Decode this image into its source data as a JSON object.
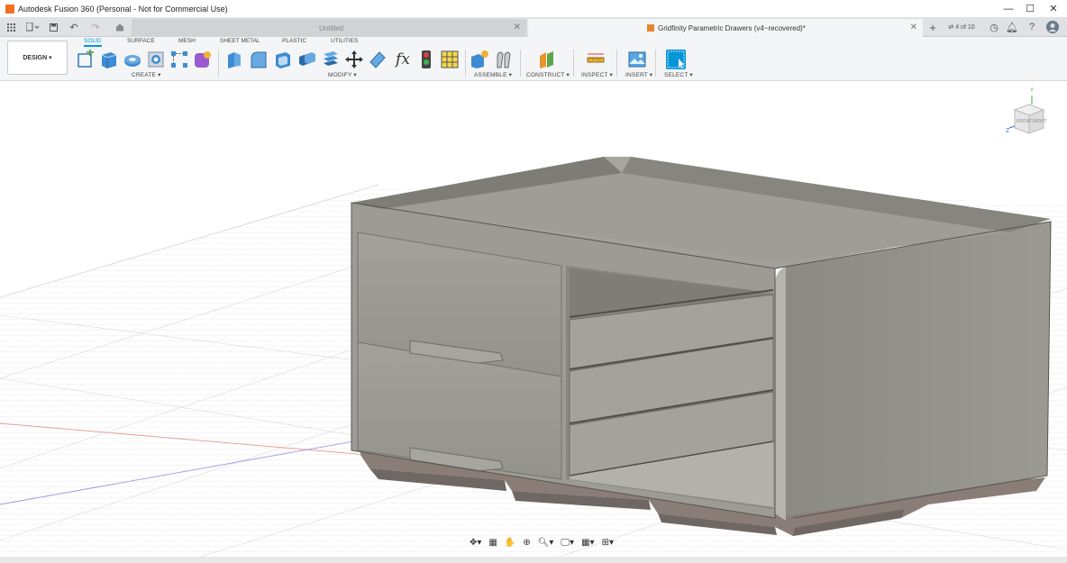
{
  "window": {
    "title": "Autodesk Fusion 360 (Personal - Not for Commercial Use)",
    "minimize": "—",
    "maximize": "☐",
    "close": "✕"
  },
  "tabs": {
    "items": [
      {
        "label": "Untitled",
        "state": "inactive"
      },
      {
        "label": "Gridfinity Parametric Drawers (v4~recovered)*",
        "state": "active"
      }
    ],
    "job_counter": "4 of 10"
  },
  "ribbon": {
    "workspace": "DESIGN ▾",
    "tabs": [
      "SOLID",
      "SURFACE",
      "MESH",
      "SHEET METAL",
      "PLASTIC",
      "UTILITIES"
    ],
    "active_tab": "SOLID",
    "groups": {
      "create": "CREATE ▾",
      "modify": "MODIFY ▾",
      "assemble": "ASSEMBLE ▾",
      "construct": "CONSTRUCT ▾",
      "inspect": "INSPECT ▾",
      "insert": "INSERT ▾",
      "select": "SELECT ▾"
    },
    "fx_label": "fx"
  },
  "viewcube": {
    "front": "FRONT",
    "right": "RIGHT",
    "axis_z": "Z",
    "axis_y": "Y"
  },
  "colors": {
    "accent": "#0696d7",
    "model_body": "#9b9b93",
    "model_dark": "#6f6f68",
    "model_base": "#8a7d78"
  }
}
